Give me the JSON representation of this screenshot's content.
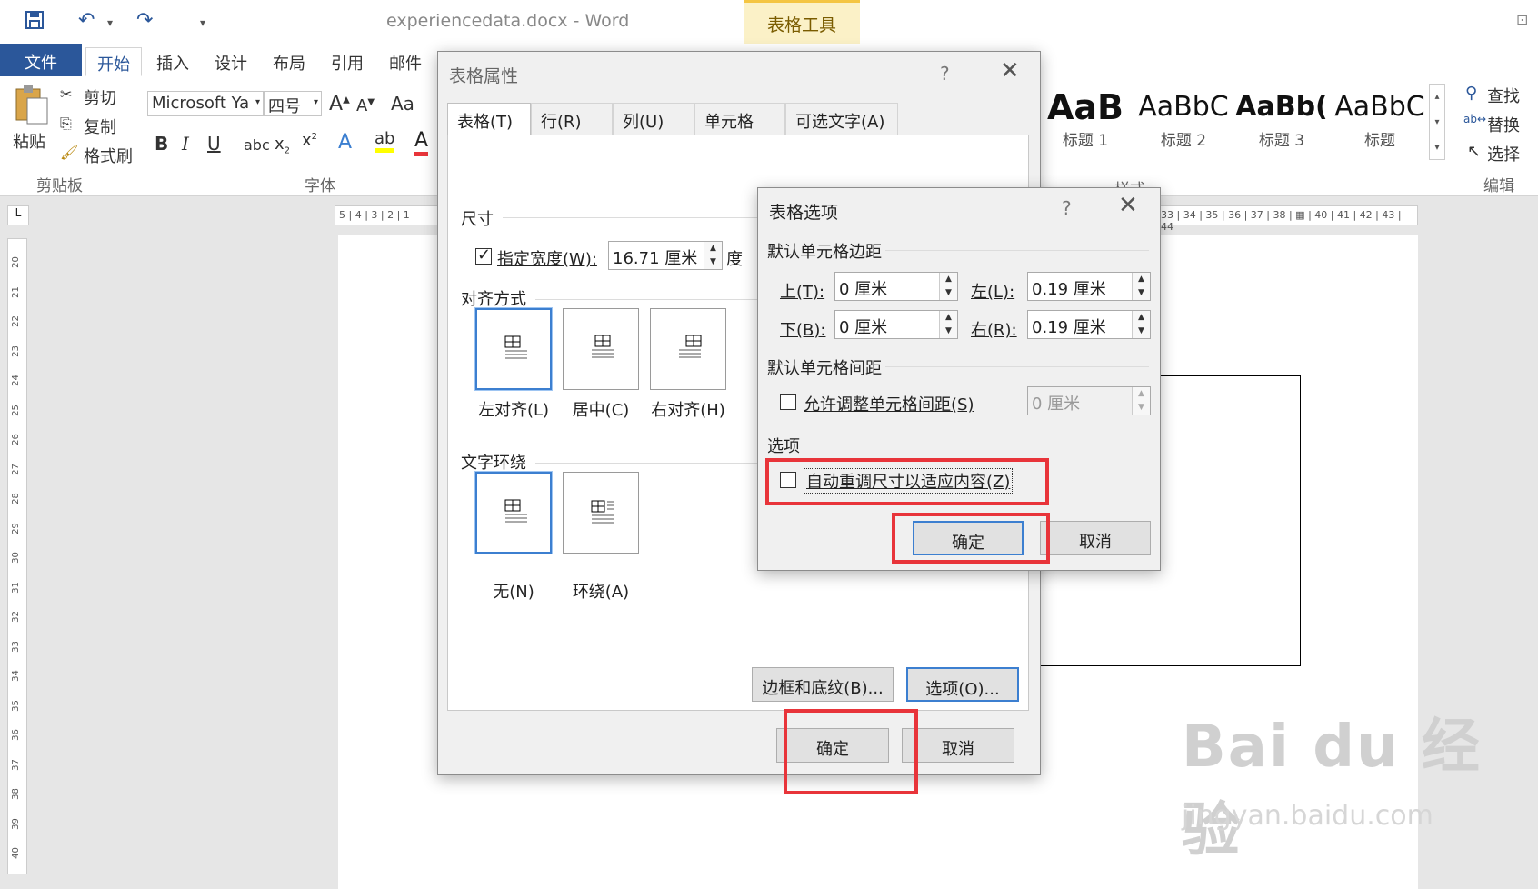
{
  "titlebar": {
    "doc_title": "experiencedata.docx - Word",
    "context_tab": "表格工具"
  },
  "tabs": {
    "file": "文件",
    "items": [
      "开始",
      "插入",
      "设计",
      "布局",
      "引用",
      "邮件"
    ]
  },
  "ribbon": {
    "paste": "粘贴",
    "cut": "剪切",
    "copy": "复制",
    "format_painter": "格式刷",
    "clipboard_label": "剪贴板",
    "font_name": "Microsoft Ya",
    "font_size": "四号",
    "font_group_label": "字体",
    "change_case": "Aa",
    "styles": [
      {
        "preview": "AaB",
        "name": "标题 1"
      },
      {
        "preview": "AaBbC",
        "name": "标题 2"
      },
      {
        "preview": "AaBb(",
        "name": "标题 3"
      },
      {
        "preview": "AaBbC",
        "name": "标题"
      }
    ],
    "styles_label": "样式",
    "find": "查找",
    "replace": "替换",
    "select": "选择",
    "editing_label": "编辑"
  },
  "ruler_h_left": "5 | 4 | 3 | 2 | 1",
  "ruler_h_right": "33 | 34 | 35 | 36 | 37 | 38 | ▦ | 40 | 41 | 42 | 43 | 44",
  "ruler_v": [
    "20",
    "21",
    "22",
    "23",
    "24",
    "25",
    "26",
    "27",
    "28",
    "29",
    "30",
    "31",
    "32",
    "33",
    "34",
    "35",
    "36",
    "37",
    "38",
    "39",
    "40"
  ],
  "table_props": {
    "title": "表格属性",
    "help": "?",
    "tabs": [
      "表格(T)",
      "行(R)",
      "列(U)",
      "单元格(E)",
      "可选文字(A)"
    ],
    "size_section": "尺寸",
    "specify_width_label": "指定宽度(W):",
    "specify_width_checked": true,
    "width_value": "16.71 厘米",
    "measure_label": "度",
    "align_section": "对齐方式",
    "align_options": [
      "左对齐(L)",
      "居中(C)",
      "右对齐(H)"
    ],
    "wrap_section": "文字环绕",
    "wrap_options": [
      "无(N)",
      "环绕(A)"
    ],
    "borders_button": "边框和底纹(B)...",
    "options_button": "选项(O)...",
    "ok_button": "确定",
    "cancel_button": "取消"
  },
  "table_options": {
    "title": "表格选项",
    "help": "?",
    "margins_section": "默认单元格边距",
    "top_label": "上(T):",
    "top_value": "0 厘米",
    "bottom_label": "下(B):",
    "bottom_value": "0 厘米",
    "left_label": "左(L):",
    "left_value": "0.19 厘米",
    "right_label": "右(R):",
    "right_value": "0.19 厘米",
    "spacing_section": "默认单元格间距",
    "allow_spacing_label": "允许调整单元格间距(S)",
    "allow_spacing_checked": false,
    "spacing_value": "0 厘米",
    "options_section": "选项",
    "autofit_label": "自动重调尺寸以适应内容(Z)",
    "autofit_checked": false,
    "ok_button": "确定",
    "cancel_button": "取消"
  },
  "watermark": {
    "brand": "Bai du 经验",
    "url": "jingyan.baidu.com"
  },
  "colors": {
    "accent": "#2b579a",
    "highlight": "#e8343a",
    "focus": "#3c7fd0"
  }
}
